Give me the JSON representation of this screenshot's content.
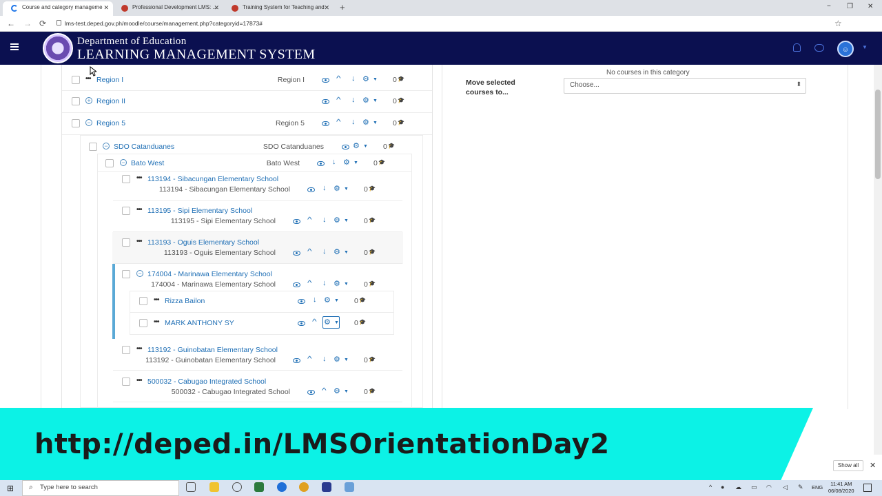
{
  "browser": {
    "tabs": [
      {
        "title": "Course and category manageme",
        "active": true,
        "favicon_color": "#1a73e8"
      },
      {
        "title": "Professional Development LMS: ...",
        "active": false,
        "favicon_color": "#c0392b"
      },
      {
        "title": "Training System for Teaching and",
        "active": false,
        "favicon_color": "#c0392b"
      }
    ],
    "new_tab": "+",
    "url": "lms-test.deped.gov.ph/moodle/course/management.php?categoryid=17873#",
    "back": "←",
    "forward": "→",
    "reload": "⟳",
    "star": "☆",
    "window_min": "−",
    "window_max": "❐",
    "window_close": "✕",
    "tab_close": "✕"
  },
  "header": {
    "title_line1": "Department of Education",
    "title_line2": "LEARNING MANAGEMENT SYSTEM",
    "logo_icon": "deped-seal",
    "avatar": "☺"
  },
  "right_panel": {
    "no_courses": "No courses in this category",
    "move_label": "Move selected courses to...",
    "choose": "Choose...",
    "select_caret": "⬍"
  },
  "categories": [
    {
      "name": "Region I",
      "idnumber": "Region I",
      "count": "0"
    },
    {
      "name": "Region II",
      "idnumber": "",
      "count": "0"
    },
    {
      "name": "Region 5",
      "idnumber": "Region 5",
      "count": "0"
    },
    {
      "name": "SDO Catanduanes",
      "idnumber": "SDO Catanduanes",
      "count": "0"
    },
    {
      "name": "Bato West",
      "idnumber": "Bato West",
      "count": "0"
    },
    {
      "name": "113194 - Sibacungan Elementary School",
      "idnumber": "113194 - Sibacungan Elementary School",
      "count": "0"
    },
    {
      "name": "113195 - Sipi Elementary School",
      "idnumber": "113195 - Sipi Elementary School",
      "count": "0"
    },
    {
      "name": "113193 - Oguis Elementary School",
      "idnumber": "113193 - Oguis Elementary School",
      "count": "0"
    },
    {
      "name": "174004 - Marinawa Elementary School",
      "idnumber": "174004 - Marinawa Elementary School",
      "count": "0"
    },
    {
      "name": "Rizza Bailon",
      "idnumber": "",
      "count": "0"
    },
    {
      "name": "MARK ANTHONY SY",
      "idnumber": "",
      "count": "0"
    },
    {
      "name": "113192 - Guinobatan Elementary School",
      "idnumber": "113192 - Guinobatan Elementary School",
      "count": "0"
    },
    {
      "name": "500032 - Cabugao Integrated School",
      "idnumber": "500032 - Cabugao Integrated School",
      "count": "0"
    }
  ],
  "glyphs": {
    "dots": "•••",
    "collapse": "−",
    "expand": "+",
    "up": "^",
    "down": "↓",
    "gear": "⚙",
    "caret": "▼",
    "cap": "🎓"
  },
  "banner": {
    "text": "http://deped.in/LMSOrientationDay2"
  },
  "overlay": {
    "show_all": "Show all",
    "close": "✕"
  },
  "taskbar": {
    "start": "⊞",
    "search_icon": "⌕",
    "search_placeholder": "Type here to search",
    "language": "ENG",
    "time": "11:41 AM",
    "date": "06/08/2020",
    "icons": [
      {
        "name": "task-view-icon",
        "color": "#555"
      },
      {
        "name": "file-explorer-icon",
        "color": "#f0c330"
      },
      {
        "name": "settings-icon",
        "color": "#555"
      },
      {
        "name": "app-icon",
        "color": "#2b7a3d"
      },
      {
        "name": "edge-icon",
        "color": "#1f6fd8"
      },
      {
        "name": "chrome-icon",
        "color": "#e0a020"
      },
      {
        "name": "photoshop-icon",
        "color": "#2a3a8f"
      },
      {
        "name": "notepad-icon",
        "color": "#6aa0d8"
      }
    ]
  }
}
